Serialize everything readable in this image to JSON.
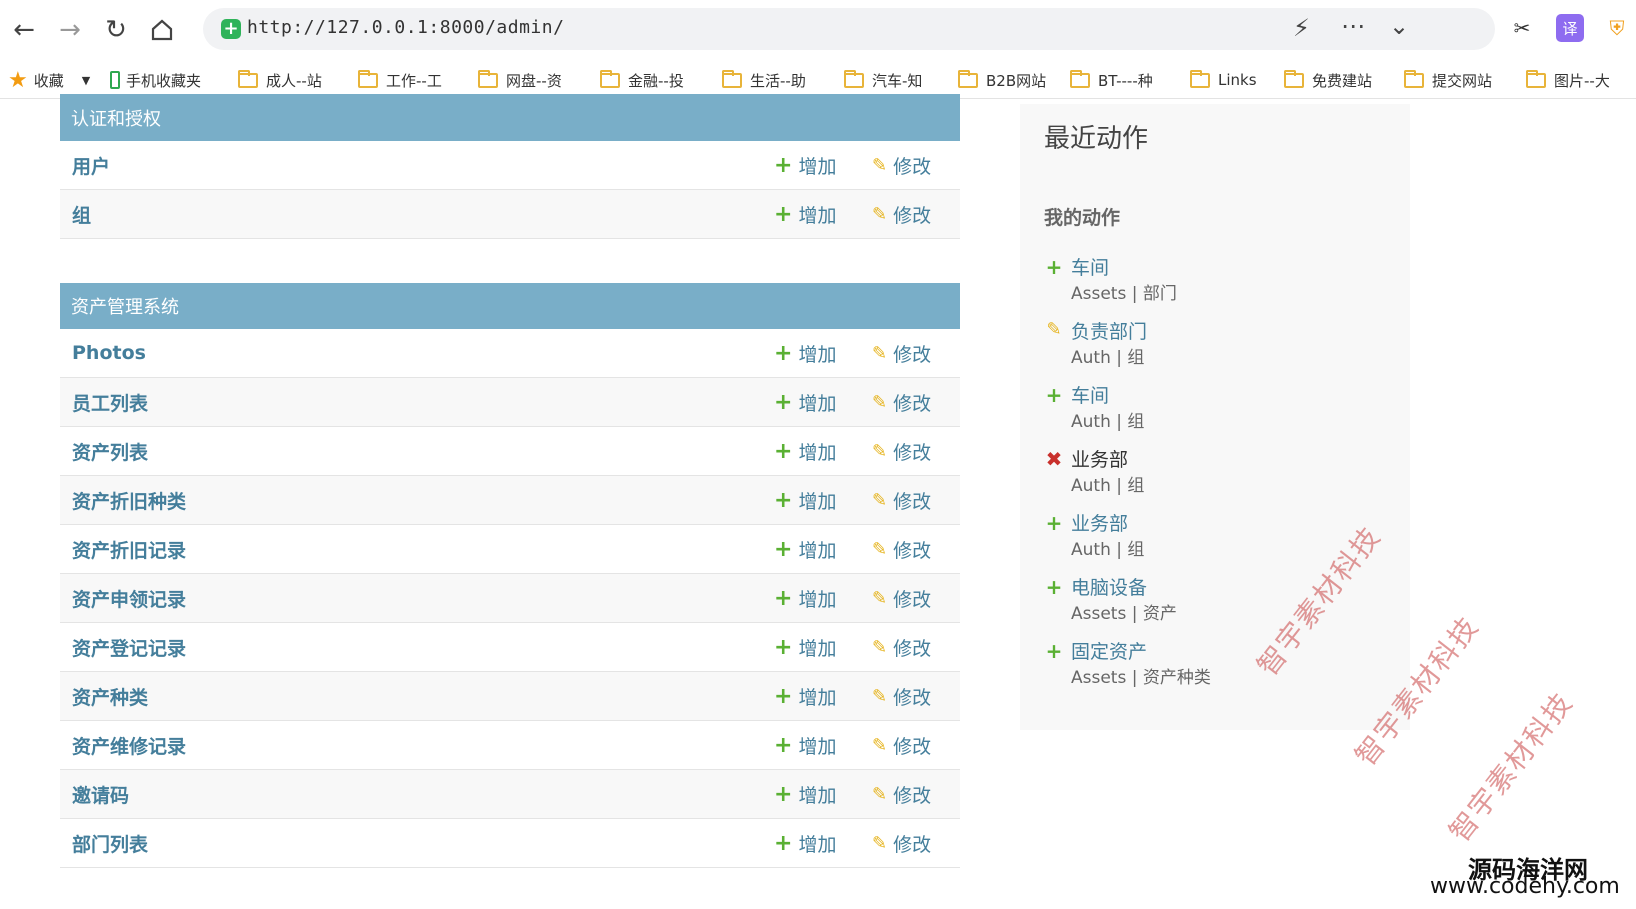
{
  "browser": {
    "url": "http://127.0.0.1:8000/admin/"
  },
  "bookmarks": [
    {
      "label": "收藏",
      "icon": "star-icon"
    },
    {
      "label": "手机收藏夹",
      "icon": "phone-icon"
    },
    {
      "label": "成人--站",
      "icon": "folder-icon"
    },
    {
      "label": "工作--工",
      "icon": "folder-icon"
    },
    {
      "label": "网盘--资",
      "icon": "folder-icon"
    },
    {
      "label": "金融--投",
      "icon": "folder-icon"
    },
    {
      "label": "生活--助",
      "icon": "folder-icon"
    },
    {
      "label": "汽车-知",
      "icon": "folder-icon"
    },
    {
      "label": "B2B网站",
      "icon": "folder-icon"
    },
    {
      "label": "BT----种",
      "icon": "folder-icon"
    },
    {
      "label": "Links",
      "icon": "folder-icon"
    },
    {
      "label": "免费建站",
      "icon": "folder-icon"
    },
    {
      "label": "提交网站",
      "icon": "folder-icon"
    },
    {
      "label": "图片--大",
      "icon": "folder-icon"
    }
  ],
  "modules": [
    {
      "caption": "认证和授权",
      "models": [
        {
          "name": "用户",
          "add": "增加",
          "change": "修改"
        },
        {
          "name": "组",
          "add": "增加",
          "change": "修改"
        }
      ]
    },
    {
      "caption": "资产管理系统",
      "models": [
        {
          "name": "Photos",
          "add": "增加",
          "change": "修改"
        },
        {
          "name": "员工列表",
          "add": "增加",
          "change": "修改"
        },
        {
          "name": "资产列表",
          "add": "增加",
          "change": "修改"
        },
        {
          "name": "资产折旧种类",
          "add": "增加",
          "change": "修改"
        },
        {
          "name": "资产折旧记录",
          "add": "增加",
          "change": "修改"
        },
        {
          "name": "资产申领记录",
          "add": "增加",
          "change": "修改"
        },
        {
          "name": "资产登记记录",
          "add": "增加",
          "change": "修改"
        },
        {
          "name": "资产种类",
          "add": "增加",
          "change": "修改"
        },
        {
          "name": "资产维修记录",
          "add": "增加",
          "change": "修改"
        },
        {
          "name": "邀请码",
          "add": "增加",
          "change": "修改"
        },
        {
          "name": "部门列表",
          "add": "增加",
          "change": "修改"
        }
      ]
    }
  ],
  "recent_actions": {
    "title": "最近动作",
    "subtitle": "我的动作",
    "items": [
      {
        "type": "add",
        "title": "车间",
        "meta": "Assets | 部门"
      },
      {
        "type": "change",
        "title": "负责部门",
        "meta": "Auth | 组"
      },
      {
        "type": "add",
        "title": "车间",
        "meta": "Auth | 组"
      },
      {
        "type": "delete",
        "title": "业务部",
        "meta": "Auth | 组"
      },
      {
        "type": "add",
        "title": "业务部",
        "meta": "Auth | 组"
      },
      {
        "type": "add",
        "title": "电脑设备",
        "meta": "Assets | 资产"
      },
      {
        "type": "add",
        "title": "固定资产",
        "meta": "Assets | 资产种类"
      }
    ]
  },
  "watermarks": {
    "diagonal": "智宇素材科技",
    "site_name": "源码海洋网",
    "site_url": "www.codehy.com"
  },
  "colors": {
    "caption_bg": "#79aec8",
    "link": "#447e9b",
    "add_green": "#5ab033",
    "change_yellow": "#e6b41e",
    "delete_red": "#c9302c"
  }
}
